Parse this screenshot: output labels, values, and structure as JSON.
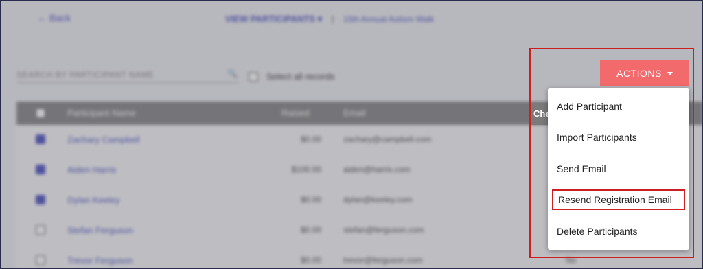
{
  "nav": {
    "back_label": "Back"
  },
  "breadcrumb": {
    "section": "VIEW PARTICIPANTS",
    "separator": "|",
    "event": "15th Annual Autism Walk"
  },
  "search": {
    "placeholder": "SEARCH BY PARTICIPANT NAME"
  },
  "select_all": {
    "label": "Select all records"
  },
  "table": {
    "columns": [
      "Participant Name",
      "Raised",
      "Email"
    ],
    "rows": [
      {
        "name": "Zachary Campbell",
        "raised": "$0.00",
        "email": "zachary@campbell.com",
        "checked": true,
        "extra": ""
      },
      {
        "name": "Aiden Harris",
        "raised": "$100.00",
        "email": "aiden@harris.com",
        "checked": true,
        "extra": ""
      },
      {
        "name": "Dylan Keeley",
        "raised": "$0.00",
        "email": "dylan@keeley.com",
        "checked": true,
        "extra": ""
      },
      {
        "name": "Stefan Ferguson",
        "raised": "$0.00",
        "email": "stefan@ferguson.com",
        "checked": false,
        "extra": ""
      },
      {
        "name": "Trevor Ferguson",
        "raised": "$0.00",
        "email": "trevor@ferguson.com",
        "checked": false,
        "extra": "No"
      }
    ],
    "partial_column_label": "Che"
  },
  "actions": {
    "button_label": "ACTIONS",
    "menu": [
      "Add Participant",
      "Import Participants",
      "Send Email",
      "Resend Registration Email",
      "Delete Participants"
    ]
  },
  "colors": {
    "accent": "#f26a6c",
    "link": "#3b3fb6",
    "highlight": "#cc1f1f",
    "header": "#7a7a7a"
  }
}
